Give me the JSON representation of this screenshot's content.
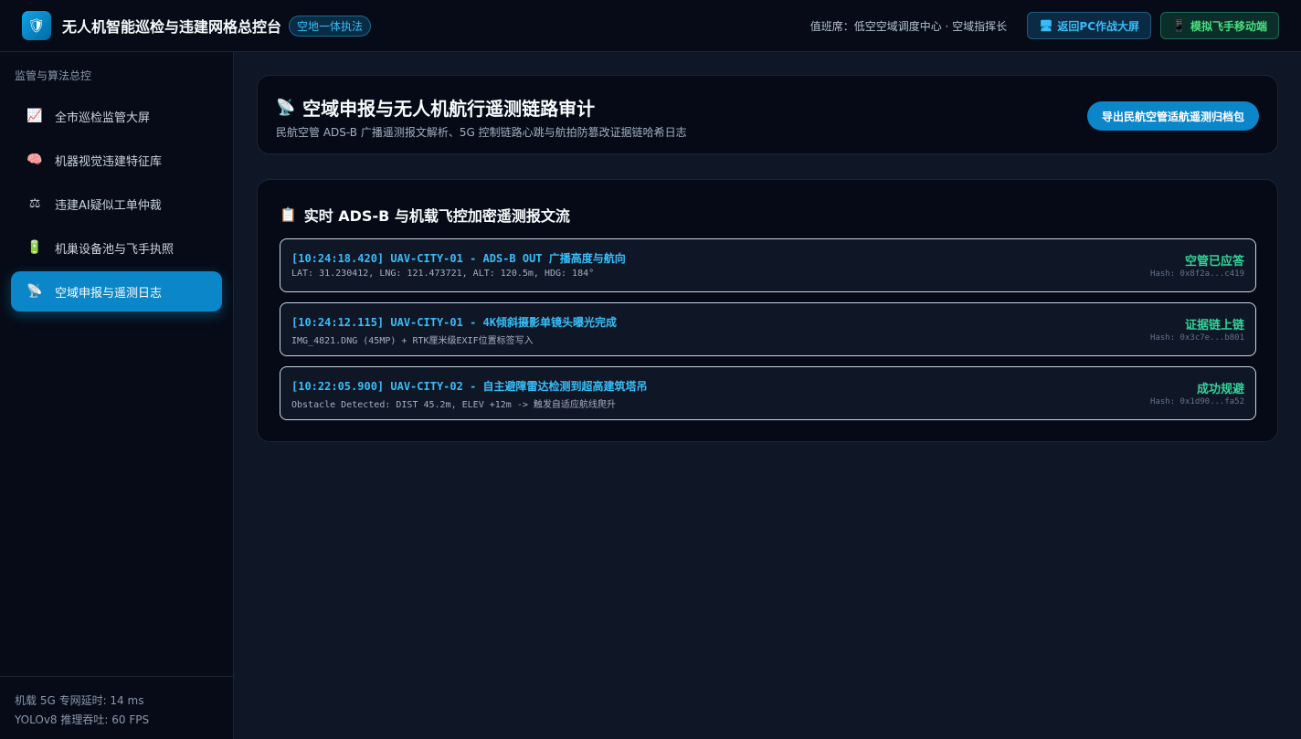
{
  "header": {
    "logo_icon": "shield-icon",
    "title": "无人机智能巡检与违建网格总控台",
    "badge": "空地一体执法",
    "duty": "值班席：低空空域调度中心 · 空域指挥长",
    "buttons": [
      {
        "label": "返回PC作战大屏",
        "icon": "monitor-icon"
      },
      {
        "label": "模拟飞手移动端",
        "icon": "phone-icon"
      }
    ]
  },
  "sidebar": {
    "section_title": "监管与算法总控",
    "items": [
      {
        "label": "全市巡检监管大屏",
        "icon": "chart-icon",
        "active": false
      },
      {
        "label": "机器视觉违建特征库",
        "icon": "brain-icon",
        "active": false
      },
      {
        "label": "违建AI疑似工单仲裁",
        "icon": "scales-icon",
        "active": false
      },
      {
        "label": "机巢设备池与飞手执照",
        "icon": "battery-icon",
        "active": false
      },
      {
        "label": "空域申报与遥测日志",
        "icon": "satellite-dish-icon",
        "active": true
      }
    ],
    "footer": {
      "latency": "机载 5G 专网延时: 14 ms",
      "fps": "YOLOv8 推理吞吐: 60 FPS"
    }
  },
  "main": {
    "title": "空域申报与无人机航行遥测链路审计",
    "title_icon": "satellite-dish-icon",
    "subtitle": "民航空管 ADS-B 广播遥测报文解析、5G 控制链路心跳与航拍防篡改证据链哈希日志",
    "export_label": "导出民航空管适航遥测归档包",
    "stream": {
      "title": "实时 ADS-B 与机载飞控加密遥测报文流",
      "title_icon": "clipboard-icon",
      "logs": [
        {
          "head": "[10:24:18.420] UAV-CITY-01 - ADS-B OUT 广播高度与航向",
          "detail": "LAT: 31.230412, LNG: 121.473721, ALT: 120.5m, HDG: 184°",
          "status": "空管已应答",
          "hash": "Hash: 0x8f2a...c419"
        },
        {
          "head": "[10:24:12.115] UAV-CITY-01 - 4K倾斜摄影单镜头曝光完成",
          "detail": "IMG_4821.DNG (45MP) + RTK厘米级EXIF位置标签写入",
          "status": "证据链上链",
          "hash": "Hash: 0x3c7e...b801"
        },
        {
          "head": "[10:22:05.900] UAV-CITY-02 - 自主避障雷达检测到超高建筑塔吊",
          "detail": "Obstacle Detected: DIST 45.2m, ELEV +12m -> 触发自适应航线爬升",
          "status": "成功规避",
          "hash": "Hash: 0x1d90...fa52"
        }
      ]
    }
  }
}
